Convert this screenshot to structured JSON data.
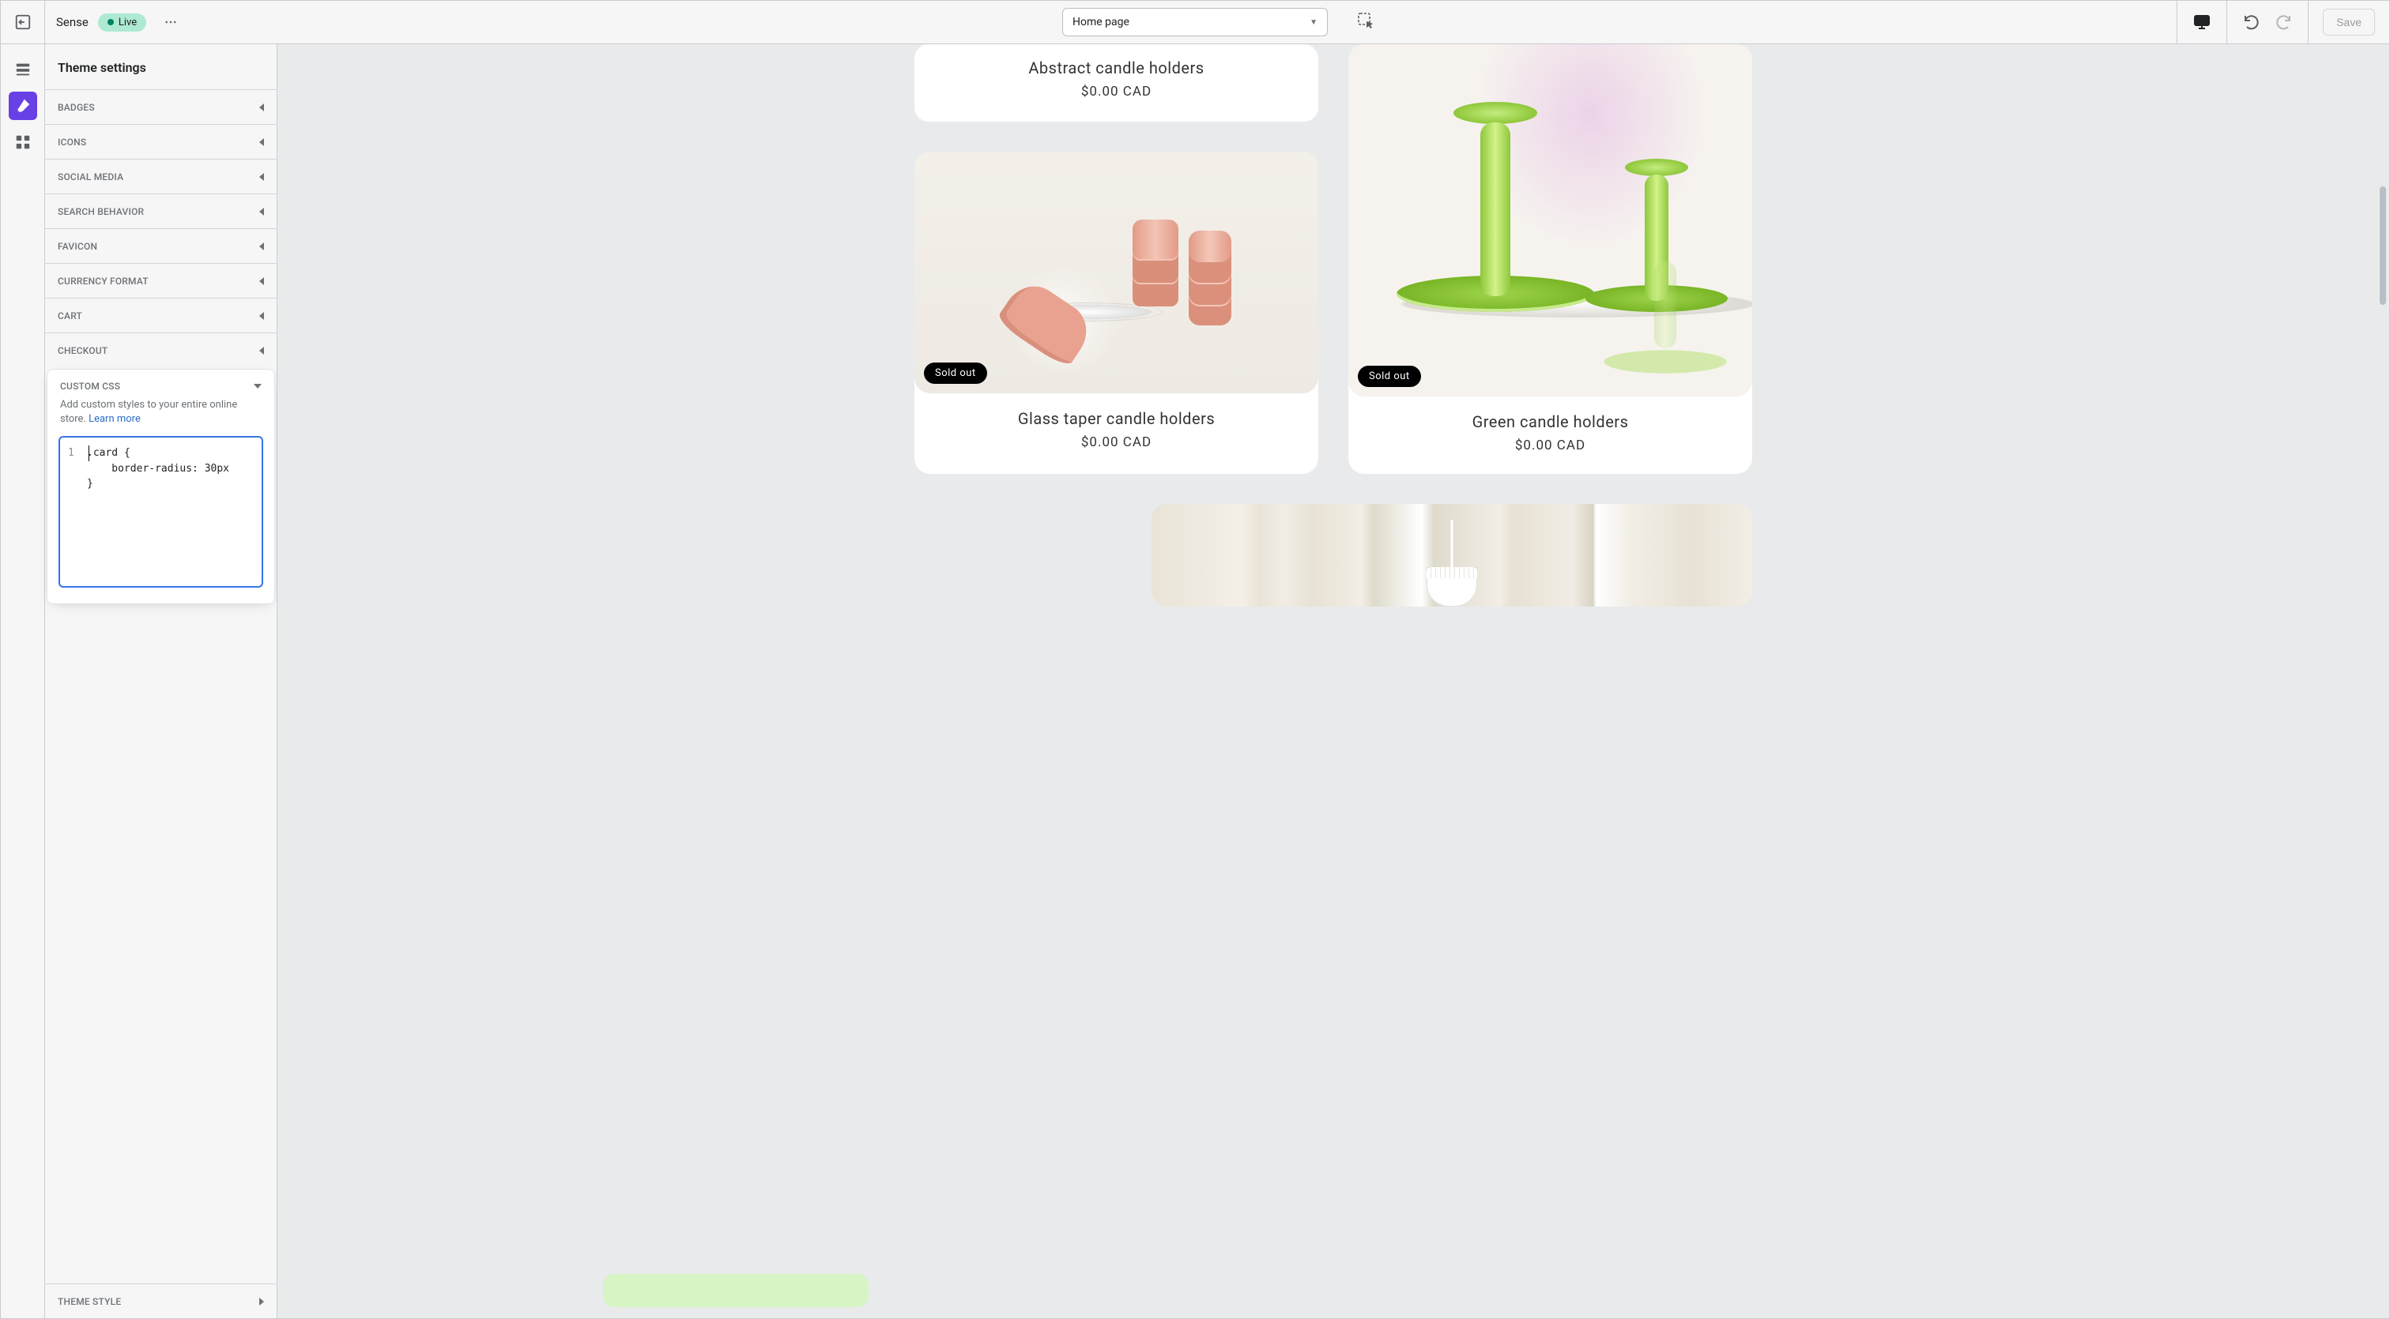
{
  "topbar": {
    "theme_name": "Sense",
    "status": "Live",
    "page_selector": "Home page",
    "save_label": "Save"
  },
  "rail": {
    "sections_tooltip": "Sections",
    "theme_settings_tooltip": "Theme settings",
    "apps_tooltip": "App embeds"
  },
  "sidebar": {
    "title": "Theme settings",
    "items": [
      "BADGES",
      "ICONS",
      "SOCIAL MEDIA",
      "SEARCH BEHAVIOR",
      "FAVICON",
      "CURRENCY FORMAT",
      "CART",
      "CHECKOUT"
    ],
    "custom_css": {
      "title": "CUSTOM CSS",
      "desc_1": "Add custom styles to ",
      "desc_bold": "your entire online store",
      "desc_2": ". ",
      "learn_more": "Learn more",
      "line_no": "1",
      "code": ".card {\n    border-radius: 30px\n}"
    },
    "theme_style": "THEME STYLE"
  },
  "preview": {
    "product_abstract": {
      "title": "Abstract candle holders",
      "price": "$0.00 CAD"
    },
    "product_taper": {
      "title": "Glass taper candle holders",
      "price": "$0.00 CAD",
      "sold_out": "Sold out"
    },
    "product_green": {
      "title": "Green candle holders",
      "price": "$0.00 CAD",
      "sold_out": "Sold out"
    }
  }
}
